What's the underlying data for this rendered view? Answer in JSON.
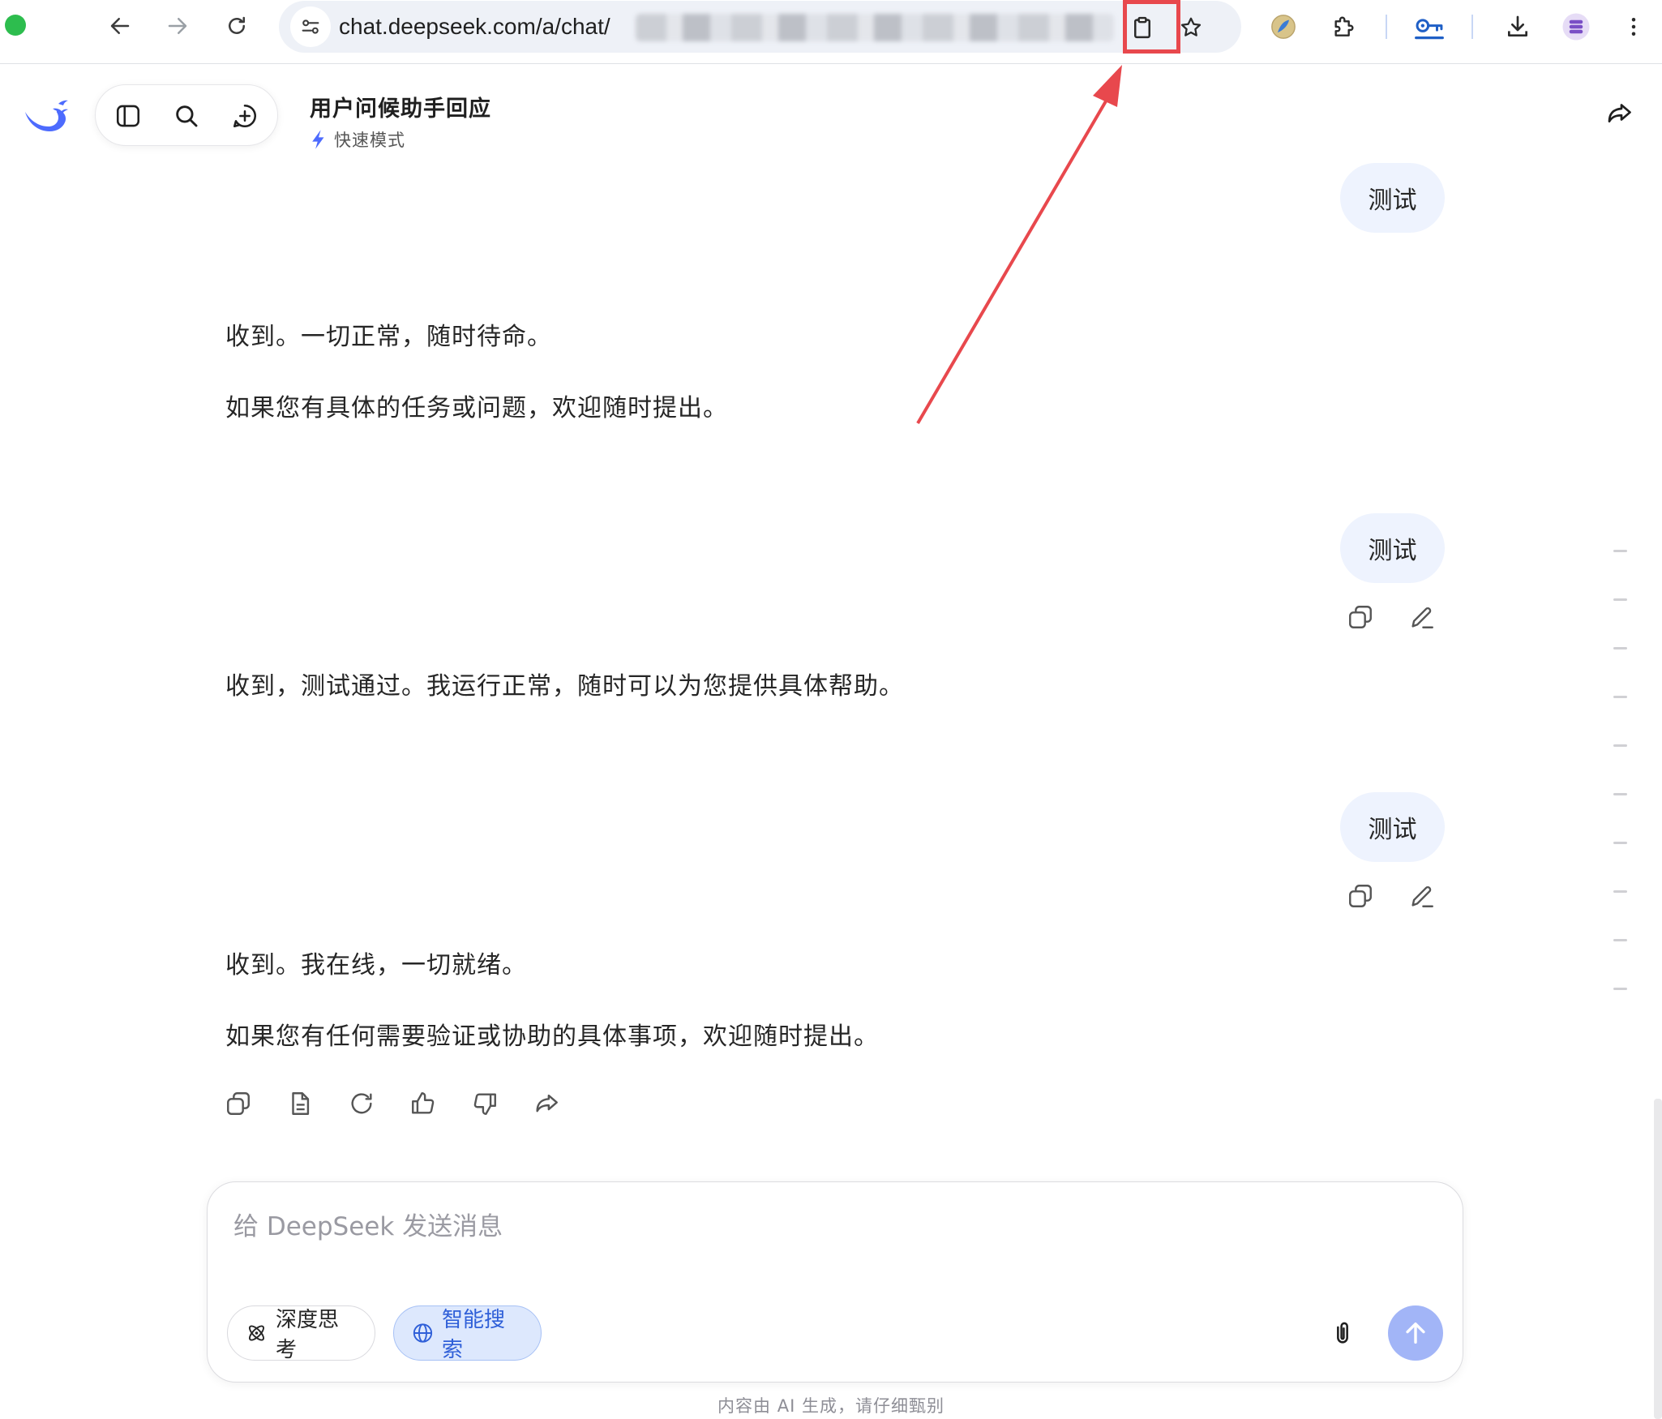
{
  "browser": {
    "url_visible": "chat.deepseek.com/a/chat/",
    "icons": {
      "back": "arrow-left-icon",
      "forward": "arrow-right-icon",
      "reload": "reload-icon",
      "site_info": "tune-icon",
      "clipboard": "clipboard-icon",
      "bookmark": "star-icon",
      "extension_1": "colorful-sphere-extension-icon",
      "extensions": "puzzle-icon",
      "password_manager": "key-icon",
      "downloads": "download-icon",
      "profile": "stack-avatar-icon",
      "menu": "kebab-menu-icon"
    },
    "highlight_color": "#e8484d"
  },
  "app": {
    "title": "用户问候助手回应",
    "mode_label": "快速模式",
    "icons": {
      "logo": "deepseek-whale-logo",
      "sidebar_toggle": "sidebar-icon",
      "search": "search-icon",
      "new_chat": "new-chat-icon",
      "share": "share-icon"
    },
    "accent_color": "#4d6bfe"
  },
  "conversation": [
    {
      "role": "user",
      "text": "测试"
    },
    {
      "role": "assistant",
      "lines": [
        "收到。一切正常，随时待命。",
        "如果您有具体的任务或问题，欢迎随时提出。"
      ]
    },
    {
      "role": "user",
      "text": "测试",
      "actions": [
        "copy-icon",
        "edit-icon"
      ]
    },
    {
      "role": "assistant",
      "lines": [
        "收到，测试通过。我运行正常，随时可以为您提供具体帮助。"
      ]
    },
    {
      "role": "user",
      "text": "测试",
      "actions": [
        "copy-icon",
        "edit-icon"
      ]
    },
    {
      "role": "assistant",
      "lines": [
        "收到。我在线，一切就绪。",
        "如果您有任何需要验证或协助的具体事项，欢迎随时提出。"
      ],
      "actions": [
        "copy-icon",
        "document-icon",
        "regenerate-icon",
        "thumbs-up-icon",
        "thumbs-down-icon",
        "share-icon"
      ]
    }
  ],
  "composer": {
    "placeholder": "给 DeepSeek 发送消息",
    "value": "",
    "deep_think_label": "深度思考",
    "smart_search_label": "智能搜索",
    "smart_search_active": true,
    "icons": {
      "deep_think": "atom-icon",
      "smart_search": "globe-icon",
      "attach": "paperclip-icon",
      "send": "arrow-up-icon"
    },
    "send_color": "#a2b5f7"
  },
  "disclaimer": "内容由 AI 生成，请仔细甄别"
}
